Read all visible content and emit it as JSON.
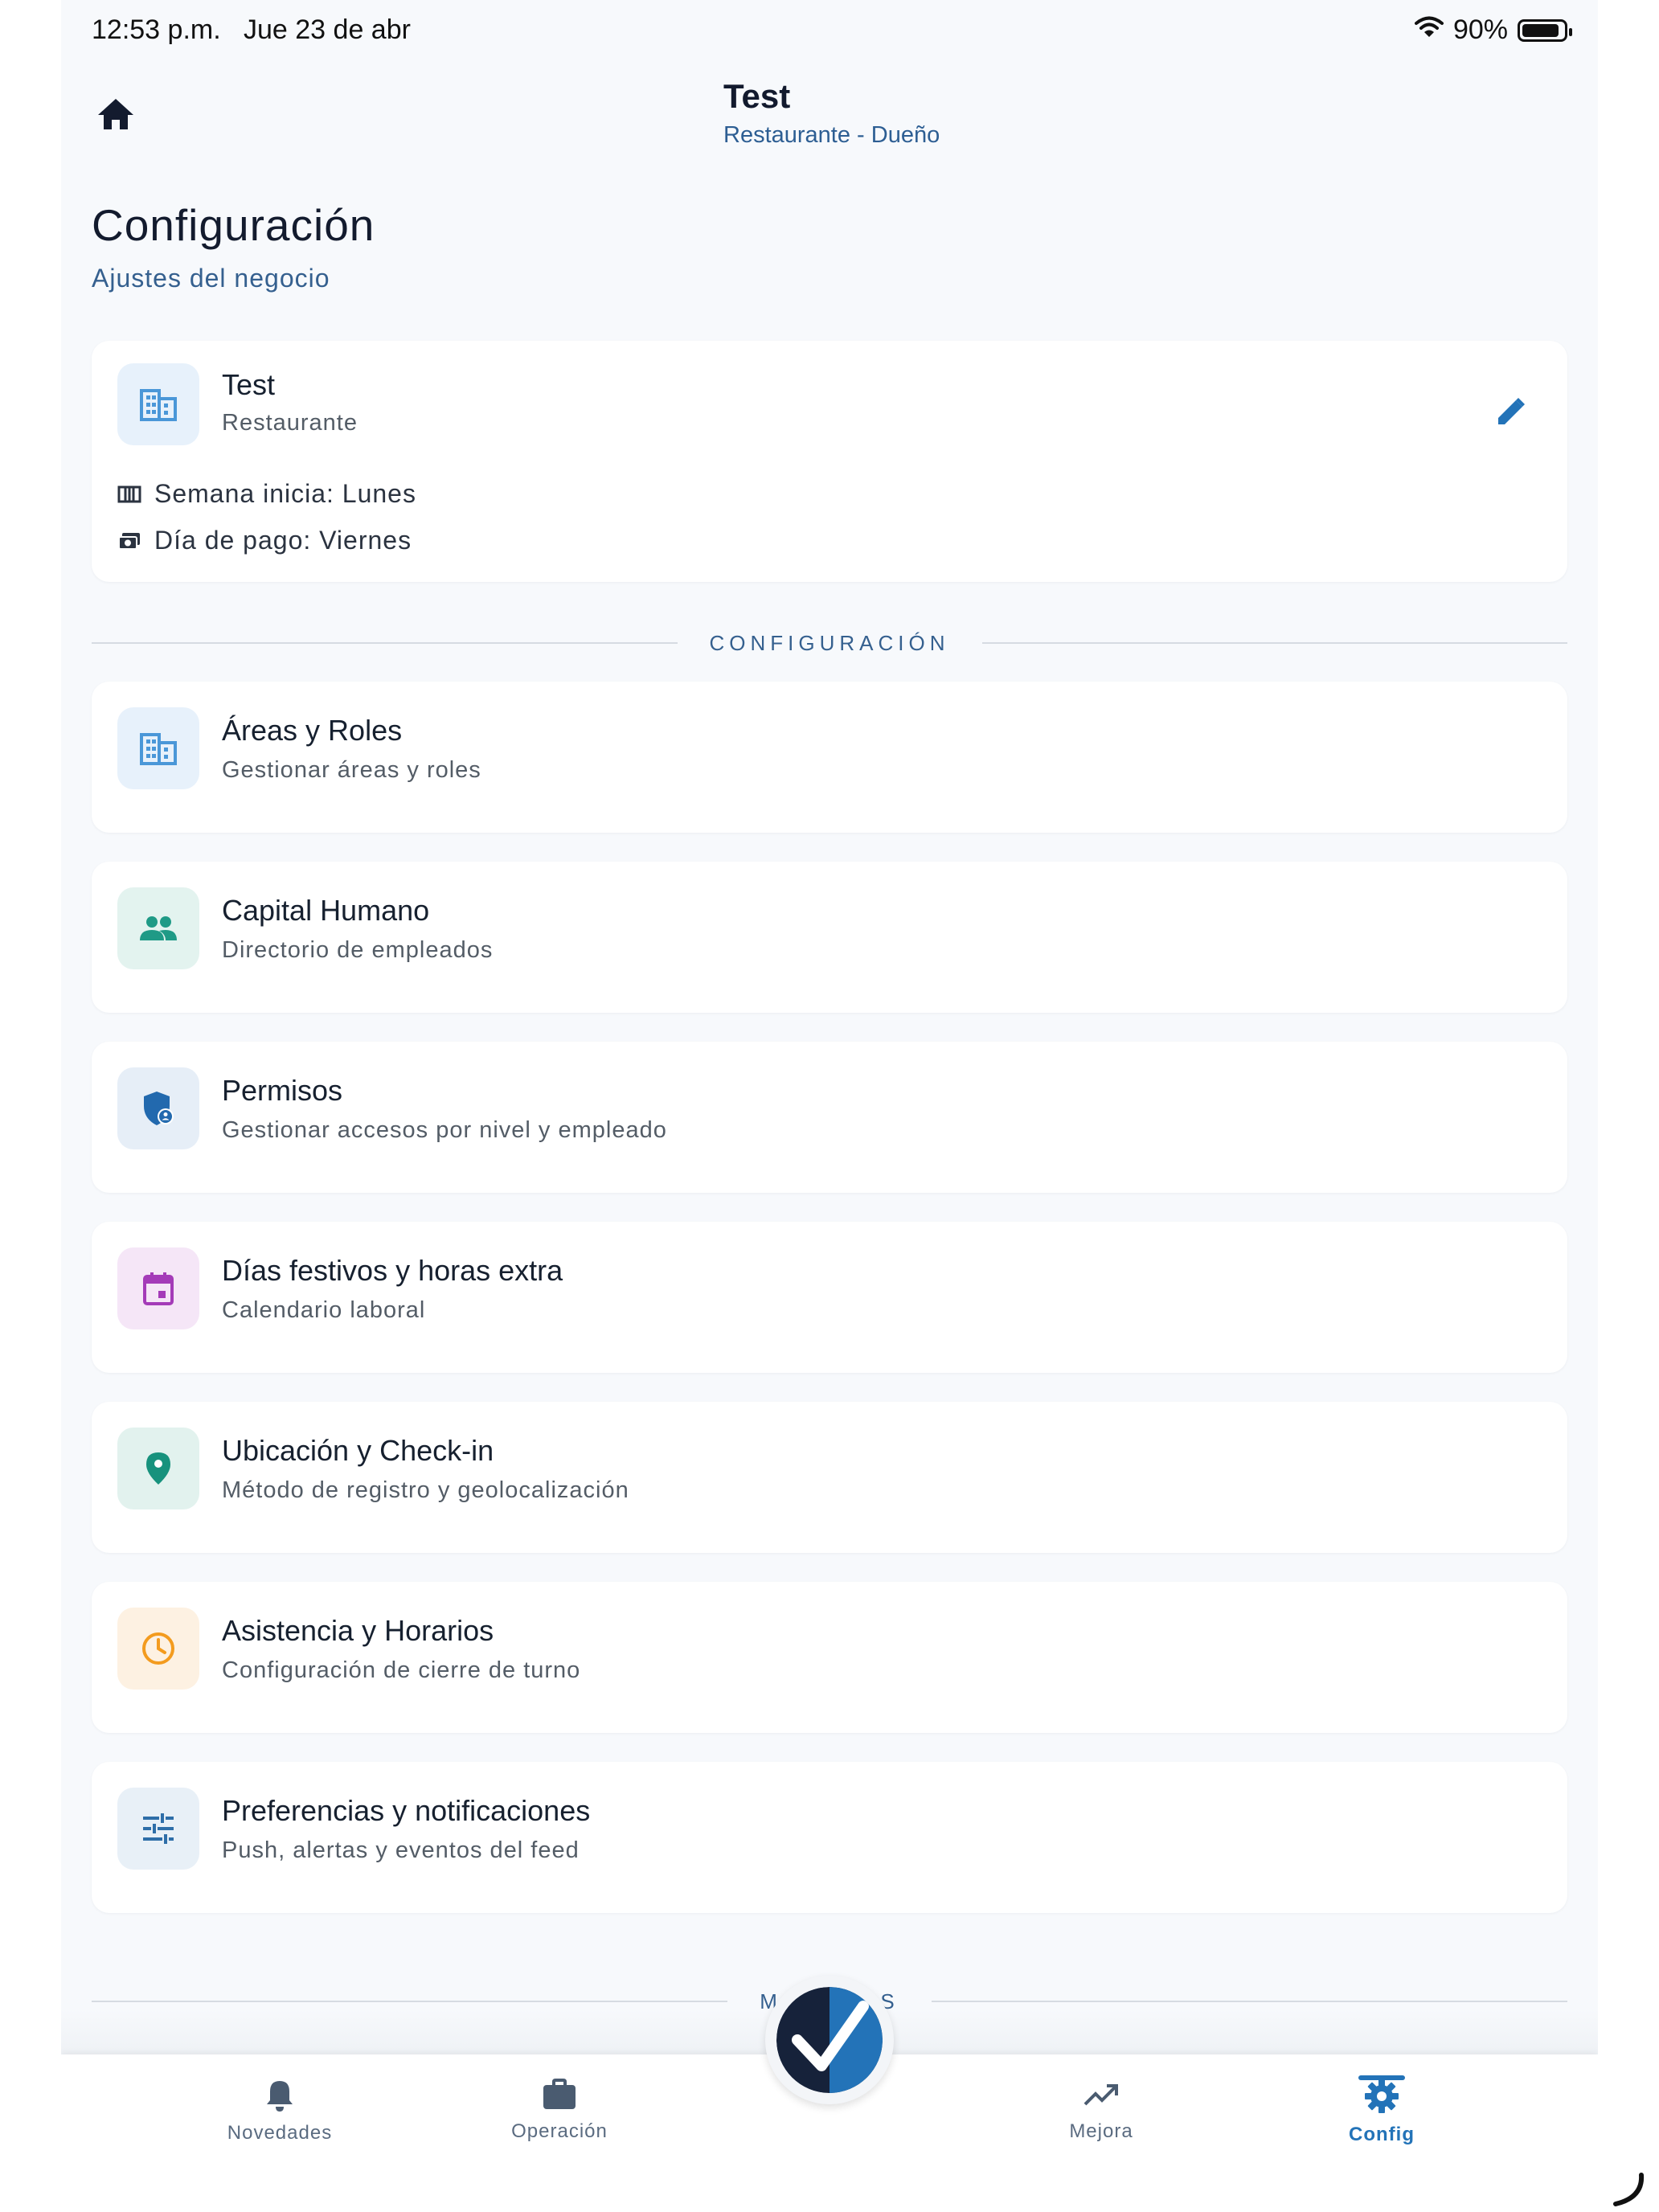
{
  "status": {
    "time": "12:53 p.m.",
    "date": "Jue 23 de abr",
    "battery": "90%",
    "battery_level": 0.9
  },
  "header": {
    "title": "Test",
    "subtitle": "Restaurante - Dueño"
  },
  "page": {
    "title": "Configuración",
    "subtitle": "Ajustes del negocio"
  },
  "business": {
    "name": "Test",
    "type": "Restaurante",
    "week_start": "Semana inicia: Lunes",
    "pay_day": "Día de pago: Viernes"
  },
  "sections": {
    "config": "CONFIGURACIÓN",
    "modules": "MÓDULOS"
  },
  "menu": [
    {
      "title": "Áreas y Roles",
      "subtitle": "Gestionar áreas y roles",
      "icon": "building-icon"
    },
    {
      "title": "Capital Humano",
      "subtitle": "Directorio de empleados",
      "icon": "people-icon"
    },
    {
      "title": "Permisos",
      "subtitle": "Gestionar accesos por nivel y empleado",
      "icon": "shield-user-icon"
    },
    {
      "title": "Días festivos y horas extra",
      "subtitle": "Calendario laboral",
      "icon": "calendar-icon"
    },
    {
      "title": "Ubicación y Check-in",
      "subtitle": "Método de registro y geolocalización",
      "icon": "location-pin-icon"
    },
    {
      "title": "Asistencia y Horarios",
      "subtitle": "Configuración de cierre de turno",
      "icon": "clock-icon"
    },
    {
      "title": "Preferencias y notificaciones",
      "subtitle": "Push, alertas y eventos del feed",
      "icon": "sliders-icon"
    }
  ],
  "nav": [
    {
      "label": "Novedades",
      "icon": "bell-icon"
    },
    {
      "label": "Operación",
      "icon": "briefcase-icon"
    },
    {
      "label": "Mejora",
      "icon": "trending-up-icon"
    },
    {
      "label": "Config",
      "icon": "gear-icon",
      "active": true
    }
  ],
  "colors": {
    "accent": "#2373b8",
    "areas": "#4a97d8",
    "areas_bg": "#e7f1fb",
    "people": "#1f9a86",
    "people_bg": "#e3f3ef",
    "shield": "#2269ae",
    "shield_bg": "#e6eef7",
    "calendar": "#a43bb8",
    "calendar_bg": "#f5e6f7",
    "pin": "#17927d",
    "pin_bg": "#e2f2ee",
    "clock": "#f39b1e",
    "clock_bg": "#fdf1e2",
    "sliders": "#2e6ea8",
    "sliders_bg": "#e8f0f7"
  }
}
